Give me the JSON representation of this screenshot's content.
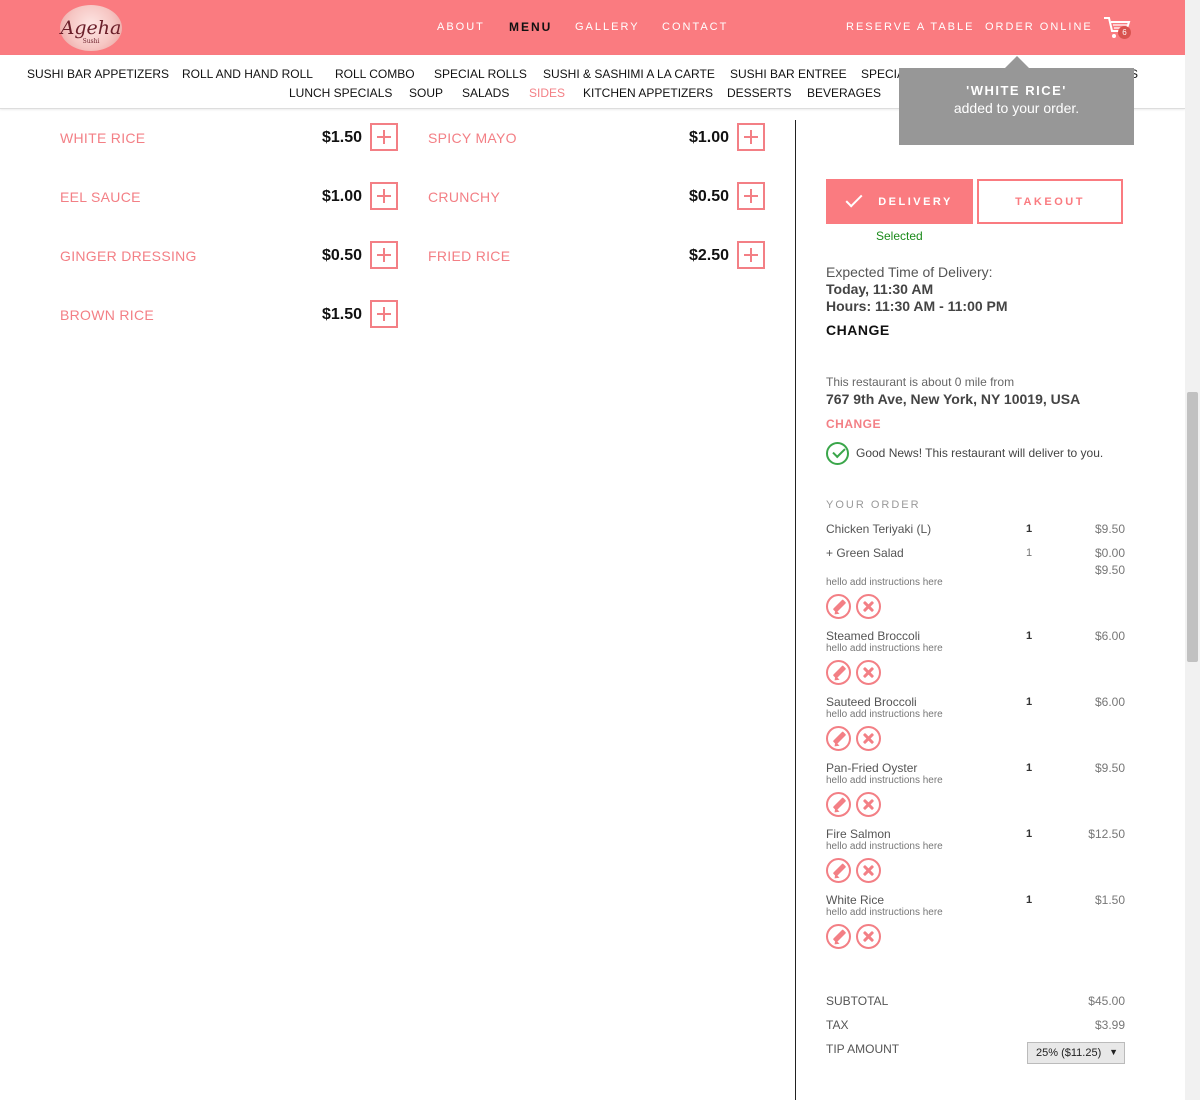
{
  "header": {
    "logo_text": "Ageha",
    "logo_sub": "Sushi",
    "nav": [
      "ABOUT",
      "MENU",
      "GALLERY",
      "CONTACT"
    ],
    "reserve_label": "RESERVE A TABLE",
    "order_online_label": "ORDER ONLINE",
    "cart_count": "6",
    "cart_icon": "shopping-cart-icon",
    "bg_color": "#fa7b80"
  },
  "categories": {
    "row1": [
      "SUSHI BAR APPETIZERS",
      "ROLL AND HAND ROLL",
      "ROLL COMBO",
      "SPECIAL ROLLS",
      "SUSHI & SASHIMI A LA CARTE",
      "SUSHI BAR ENTREE",
      "SPECIA",
      "S"
    ],
    "row2": [
      "LUNCH SPECIALS",
      "SOUP",
      "SALADS",
      "SIDES",
      "KITCHEN APPETIZERS",
      "DESSERTS",
      "BEVERAGES"
    ],
    "active": "SIDES"
  },
  "toast": {
    "line1": "'WHITE RICE'",
    "line2": "added to your order."
  },
  "menu_items": [
    {
      "name": "WHITE RICE",
      "price": "$1.50"
    },
    {
      "name": "SPICY MAYO",
      "price": "$1.00"
    },
    {
      "name": "EEL SAUCE",
      "price": "$1.00"
    },
    {
      "name": "CRUNCHY",
      "price": "$0.50"
    },
    {
      "name": "GINGER DRESSING",
      "price": "$0.50"
    },
    {
      "name": "FRIED RICE",
      "price": "$2.50"
    },
    {
      "name": "BROWN RICE",
      "price": "$1.50"
    }
  ],
  "order_panel": {
    "delivery_label": "DELIVERY",
    "takeout_label": "TAKEOUT",
    "selected_label": "Selected",
    "expected_label": "Expected Time of Delivery:",
    "expected_time": "Today, 11:30 AM",
    "hours": "Hours: 11:30 AM - 11:00 PM",
    "change_time_label": "CHANGE",
    "distance_text": "This restaurant is about 0 mile from",
    "address": "767 9th Ave, New York, NY 10019, USA",
    "change_address_label": "CHANGE",
    "good_news": "Good News! This restaurant will deliver to you.",
    "your_order_label": "YOUR ORDER",
    "order_lines": [
      {
        "name": "Chicken Teriyaki (L)",
        "qty": "1",
        "price": "$9.50",
        "modifier": "+ Green Salad",
        "modifier_qty": "1",
        "modifier_price": "$0.00",
        "line_total": "$9.50",
        "note": "hello add instructions here"
      },
      {
        "name": "Steamed Broccoli",
        "qty": "1",
        "price": "$6.00",
        "note": "hello add instructions here"
      },
      {
        "name": "Sauteed Broccoli",
        "qty": "1",
        "price": "$6.00",
        "note": "hello add instructions here"
      },
      {
        "name": "Pan-Fried Oyster",
        "qty": "1",
        "price": "$9.50",
        "note": "hello add instructions here"
      },
      {
        "name": "Fire Salmon",
        "qty": "1",
        "price": "$12.50",
        "note": "hello add instructions here"
      },
      {
        "name": "White Rice",
        "qty": "1",
        "price": "$1.50",
        "note": "hello add instructions here"
      }
    ],
    "subtotal_label": "SUBTOTAL",
    "subtotal": "$45.00",
    "tax_label": "TAX",
    "tax": "$3.99",
    "tip_label": "TIP AMOUNT",
    "tip_value": "25% ($11.25)"
  }
}
